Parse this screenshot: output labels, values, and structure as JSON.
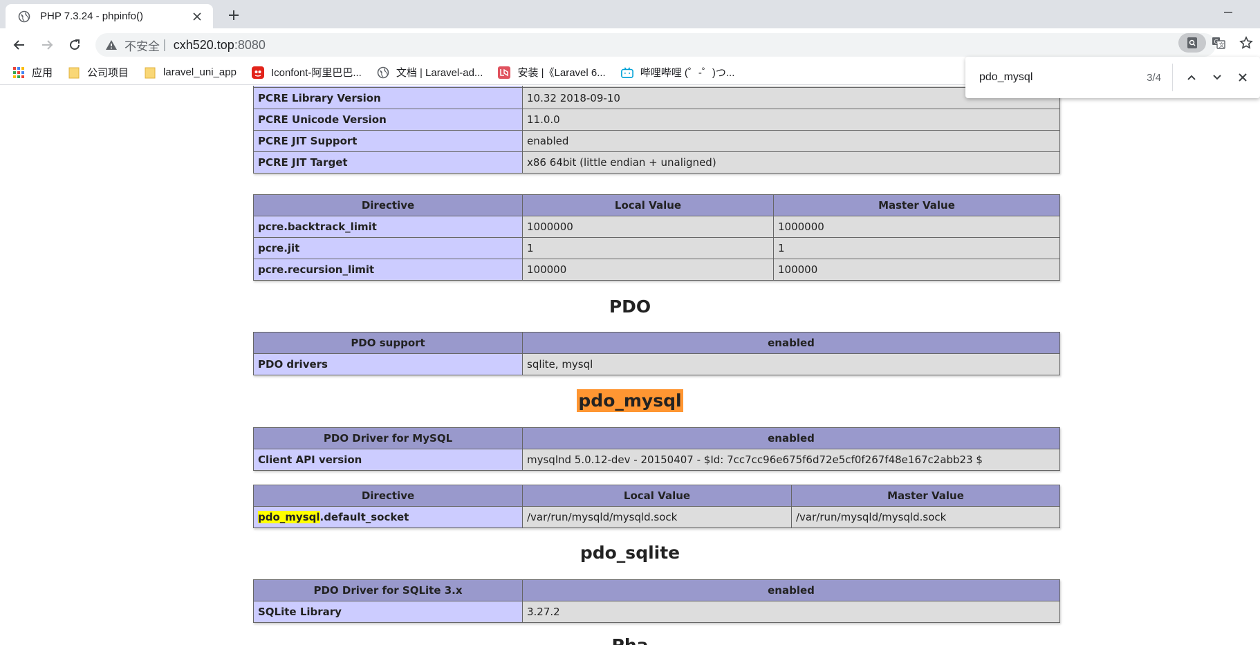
{
  "browser": {
    "tab_title": "PHP 7.3.24 - phpinfo()",
    "address": {
      "security_label": "不安全",
      "separator": "|",
      "host": "cxh520.top",
      "port": ":8080"
    },
    "bookmarks": [
      {
        "label": "应用",
        "icon": "apps-grid-icon"
      },
      {
        "label": "公司项目",
        "icon": "folder-icon"
      },
      {
        "label": "laravel_uni_app",
        "icon": "folder-icon"
      },
      {
        "label": "Iconfont-阿里巴巴...",
        "icon": "iconfont-icon"
      },
      {
        "label": "文档 | Laravel-ad...",
        "icon": "globe-icon"
      },
      {
        "label": "安装 |《Laravel 6...",
        "icon": "laravel-icon"
      },
      {
        "label": "哔哩哔哩 (゜-゜)つ...",
        "icon": "bilibili-icon"
      }
    ],
    "find": {
      "query": "pdo_mysql",
      "count": "3/4"
    }
  },
  "colors": {
    "header_bg": "#9999cc",
    "key_bg": "#ccccff",
    "value_bg": "#dddddd",
    "match_active": "#ff9632",
    "match": "#ffff00"
  },
  "pcre_info": {
    "rows": [
      {
        "key": "PCRE Library Version",
        "value": "10.32 2018-09-10"
      },
      {
        "key": "PCRE Unicode Version",
        "value": "11.0.0"
      },
      {
        "key": "PCRE JIT Support",
        "value": "enabled"
      },
      {
        "key": "PCRE JIT Target",
        "value": "x86 64bit (little endian + unaligned)"
      }
    ]
  },
  "pcre_directives": {
    "headers": [
      "Directive",
      "Local Value",
      "Master Value"
    ],
    "rows": [
      {
        "key": "pcre.backtrack_limit",
        "local": "1000000",
        "master": "1000000"
      },
      {
        "key": "pcre.jit",
        "local": "1",
        "master": "1"
      },
      {
        "key": "pcre.recursion_limit",
        "local": "100000",
        "master": "100000"
      }
    ]
  },
  "pdo": {
    "heading": "PDO",
    "headers": [
      "PDO support",
      "enabled"
    ],
    "rows": [
      {
        "key": "PDO drivers",
        "value": "sqlite, mysql"
      }
    ]
  },
  "pdo_mysql": {
    "heading": "pdo_mysql",
    "headers": [
      "PDO Driver for MySQL",
      "enabled"
    ],
    "rows": [
      {
        "key": "Client API version",
        "value": "mysqlnd 5.0.12-dev - 20150407 - $Id: 7cc7cc96e675f6d72e5cf0f267f48e167c2abb23 $"
      }
    ],
    "directive_headers": [
      "Directive",
      "Local Value",
      "Master Value"
    ],
    "directives": [
      {
        "key_match": "pdo_mysql",
        "key_rest": ".default_socket",
        "local": "/var/run/mysqld/mysqld.sock",
        "master": "/var/run/mysqld/mysqld.sock"
      }
    ]
  },
  "pdo_sqlite": {
    "heading": "pdo_sqlite",
    "headers": [
      "PDO Driver for SQLite 3.x",
      "enabled"
    ],
    "rows": [
      {
        "key": "SQLite Library",
        "value": "3.27.2"
      }
    ]
  },
  "next_heading_partial": "Pha"
}
